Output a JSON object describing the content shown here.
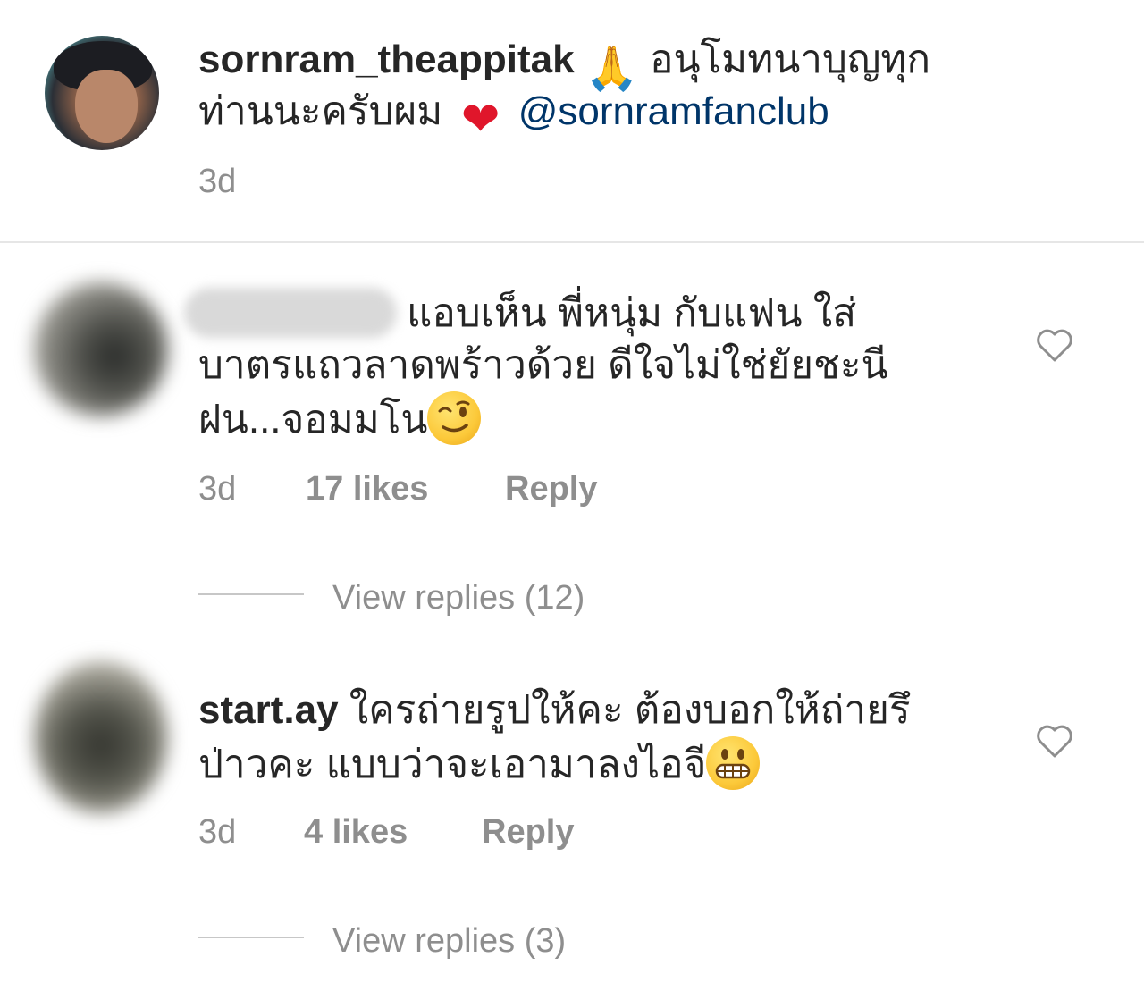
{
  "caption": {
    "username": "sornram_theappitak",
    "text_line1": "อนุโมทนาบุญทุก",
    "text_line2": "ท่านนะครับผม",
    "mention": "@sornramfanclub",
    "emoji_1": "pray-emoji",
    "emoji_2": "heart-emoji",
    "time": "3d"
  },
  "comments": [
    {
      "username_blurred": true,
      "line1": "แอบเห็น พี่หนุ่ม กับแฟน ใส่",
      "line2": "บาตรแถวลาดพร้าวด้วย  ดีใจไม่ใช่ยัยชะนี",
      "line3": "ฝน...จอมมโน",
      "emoji": "winking-face-emoji",
      "time": "3d",
      "likes": "17 likes",
      "reply": "Reply",
      "view_replies": "View replies (12)"
    },
    {
      "username": "start.ay",
      "line1": "ใครถ่ายรูปให้คะ ต้องบอกให้ถ่ายรึ",
      "line2": "ป่าวคะ แบบว่าจะเอามาลงไอจี",
      "emoji": "grimacing-face-emoji",
      "time": "3d",
      "likes": "4 likes",
      "reply": "Reply",
      "view_replies": "View replies (3)"
    }
  ],
  "colors": {
    "text": "#262626",
    "muted": "#8e8e8e",
    "mention": "#003569",
    "divider": "#e6e6e6"
  }
}
